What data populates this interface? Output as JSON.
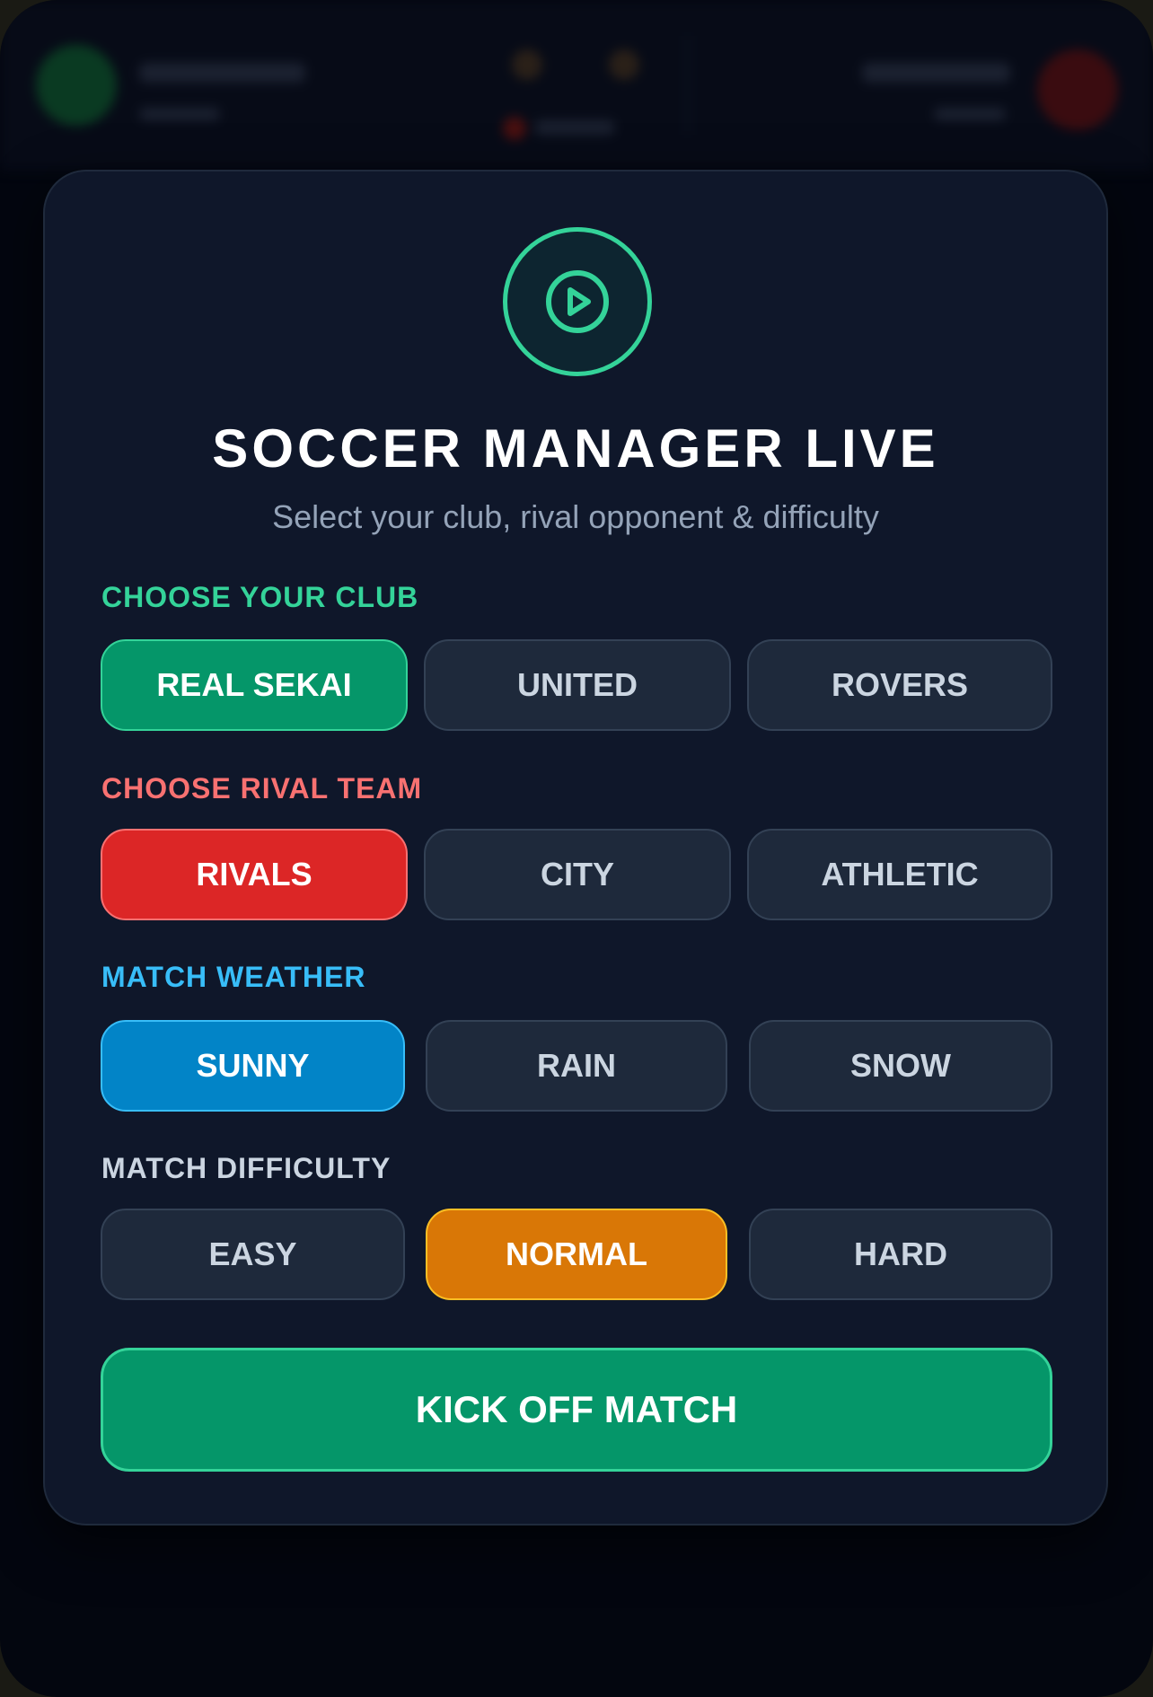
{
  "app": {
    "title": "SOCCER MANAGER LIVE",
    "subtitle": "Select your club, rival opponent & difficulty"
  },
  "sections": {
    "club": {
      "label": "CHOOSE YOUR CLUB",
      "color": "#34d399",
      "options": [
        "REAL SEKAI",
        "UNITED",
        "ROVERS"
      ],
      "selected": "REAL SEKAI"
    },
    "rival": {
      "label": "CHOOSE RIVAL TEAM",
      "color": "#f87171",
      "options": [
        "RIVALS",
        "CITY",
        "ATHLETIC"
      ],
      "selected": "RIVALS"
    },
    "weather": {
      "label": "MATCH WEATHER",
      "color": "#38bdf8",
      "options": [
        "SUNNY",
        "RAIN",
        "SNOW"
      ],
      "selected": "SUNNY"
    },
    "difficulty": {
      "label": "MATCH DIFFICULTY",
      "color": "#cbd5e1",
      "options": [
        "EASY",
        "NORMAL",
        "HARD"
      ],
      "selected": "NORMAL"
    }
  },
  "actions": {
    "kickoff_label": "KICK OFF MATCH"
  },
  "icons": {
    "logo": "play-circle-icon"
  },
  "colors": {
    "accent": "#34d399",
    "modal_bg": "#0f172a",
    "page_bg": "#03060f"
  }
}
